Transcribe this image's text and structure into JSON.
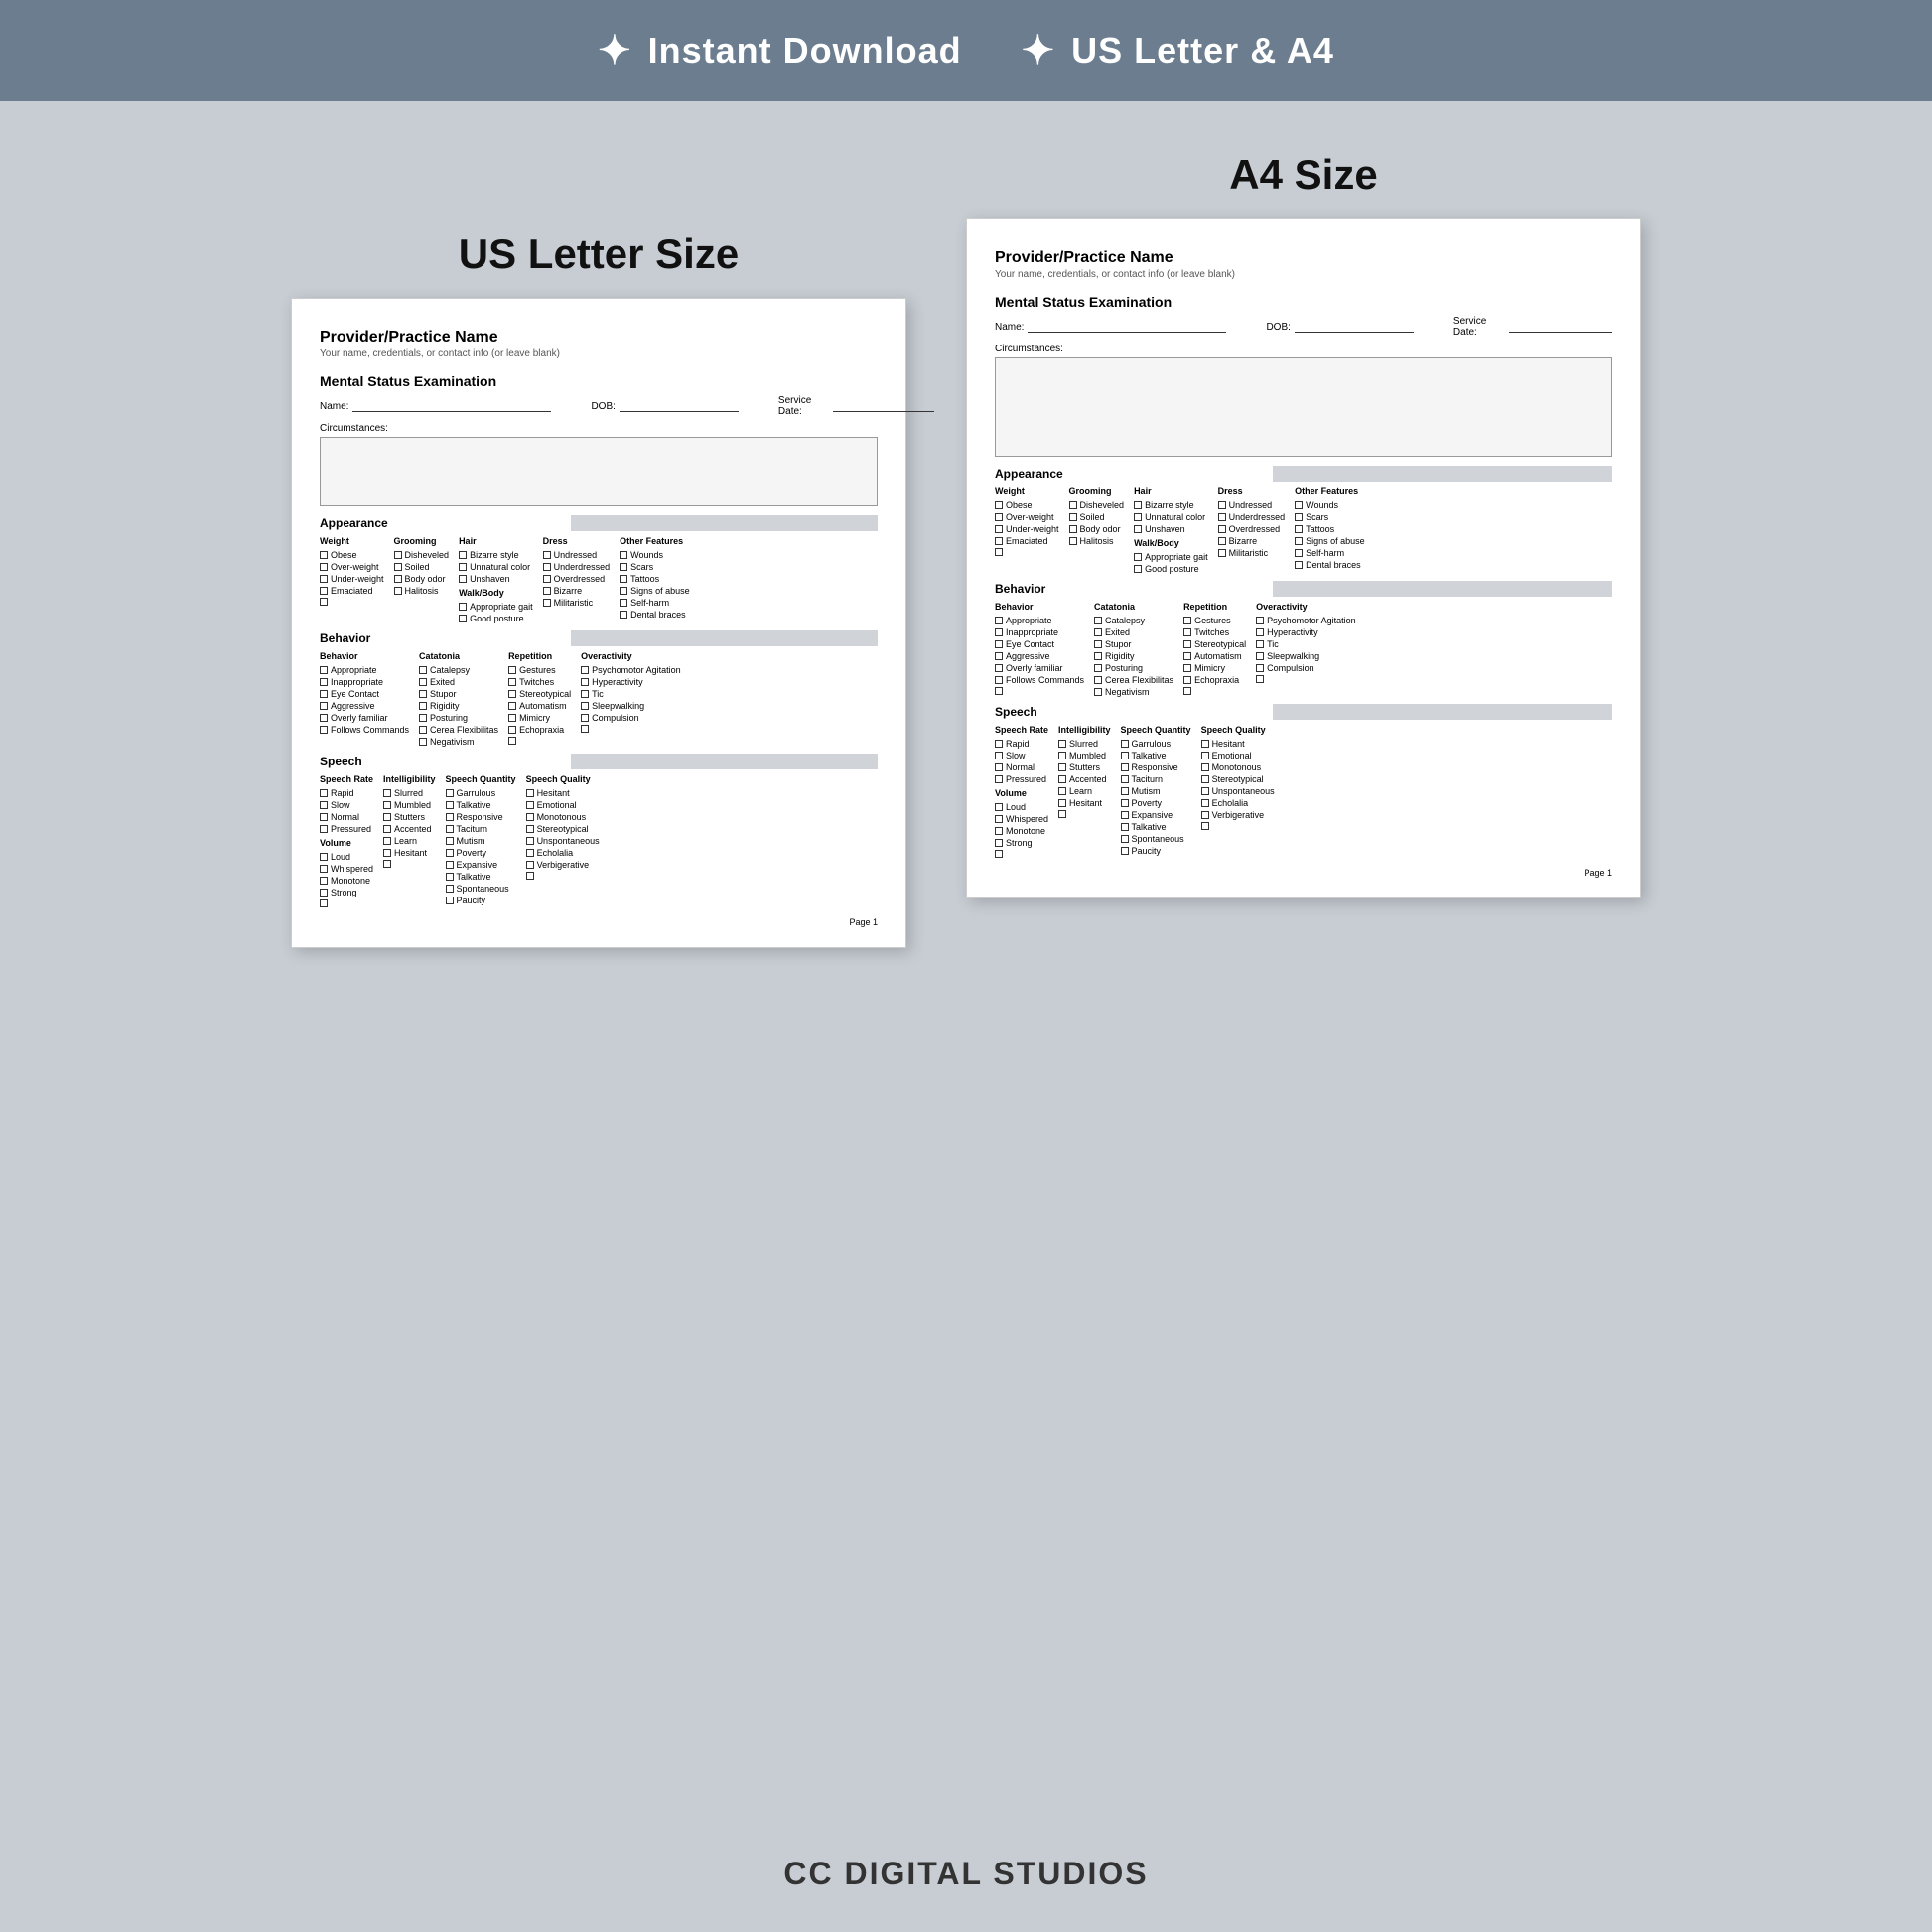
{
  "banner": {
    "item1": "Instant Download",
    "item2": "US Letter & A4"
  },
  "us_label": "US Letter Size",
  "a4_label": "A4 Size",
  "brand": "CC DIGITAL STUDIOS",
  "doc": {
    "provider_name": "Provider/Practice Name",
    "provider_sub": "Your name, credentials, or contact info (or leave blank)",
    "section_mse": "Mental Status Examination",
    "name_label": "Name:",
    "dob_label": "DOB:",
    "service_date_label": "Service Date:",
    "circumstances_label": "Circumstances:",
    "appearance_label": "Appearance",
    "behavior_label": "Behavior",
    "speech_label": "Speech",
    "page_label": "Page 1",
    "appearance": {
      "columns": [
        {
          "header": "Weight",
          "items": [
            "Obese",
            "Over-weight",
            "Under-weight",
            "Emaciated",
            ""
          ]
        },
        {
          "header": "Grooming",
          "items": [
            "Disheveled",
            "Soiled",
            "Body odor",
            "Halitosis",
            ""
          ]
        },
        {
          "header": "Hair",
          "items": [
            "Bizarre style",
            "Unnatural color",
            "Unshaven",
            "Walk/Body",
            "Appropriate gait",
            "Good posture"
          ]
        },
        {
          "header": "Dress",
          "items": [
            "Undressed",
            "Underdressed",
            "Overdressed",
            "Bizarre",
            "Militaristic",
            ""
          ]
        },
        {
          "header": "Other Features",
          "items": [
            "Wounds",
            "Scars",
            "Tattoos",
            "Signs of abuse",
            "Self-harm",
            "Dental braces"
          ]
        }
      ]
    },
    "behavior": {
      "columns": [
        {
          "header": "Behavior",
          "items": [
            "Appropriate",
            "Inappropriate",
            "Eye Contact",
            "Aggressive",
            "Overly familiar",
            "Follows Commands"
          ]
        },
        {
          "header": "Catatonia",
          "items": [
            "Catalepsy",
            "Exited",
            "Stupor",
            "Rigidity",
            "Posturing",
            "Cerea Flexibilitas",
            "Negativism"
          ]
        },
        {
          "header": "Repetition",
          "items": [
            "Gestures",
            "Twitches",
            "Stereotypical",
            "Automatism",
            "Mimicry",
            "Echopraxia",
            ""
          ]
        },
        {
          "header": "Overactivity",
          "items": [
            "Psychomotor Agitation",
            "Hyperactivity",
            "Tic",
            "Sleepwalking",
            "Compulsion",
            "",
            ""
          ]
        }
      ]
    },
    "speech": {
      "columns": [
        {
          "header": "Speech Rate",
          "items": [
            "Rapid",
            "Slow",
            "Normal",
            "Pressured",
            "Volume",
            "Loud",
            "Whispered",
            "Monotone",
            "Strong"
          ]
        },
        {
          "header": "Intelligibility",
          "items": [
            "Slurred",
            "Mumbled",
            "Stutters",
            "Accented",
            "Learn",
            "Hesitant",
            ""
          ]
        },
        {
          "header": "Speech Quantity",
          "items": [
            "Garrulous",
            "Talkative",
            "Responsive",
            "Taciturn",
            "Mutism",
            "Poverty",
            "Expansive",
            "Talkative",
            "Spontaneous",
            "Paucity"
          ]
        },
        {
          "header": "Speech Quality",
          "items": [
            "Hesitant",
            "Emotional",
            "Monotonous",
            "Stereotypical",
            "Unspontaneous",
            "Echolalia",
            "Verbigerative",
            "",
            "",
            ""
          ]
        }
      ]
    }
  }
}
